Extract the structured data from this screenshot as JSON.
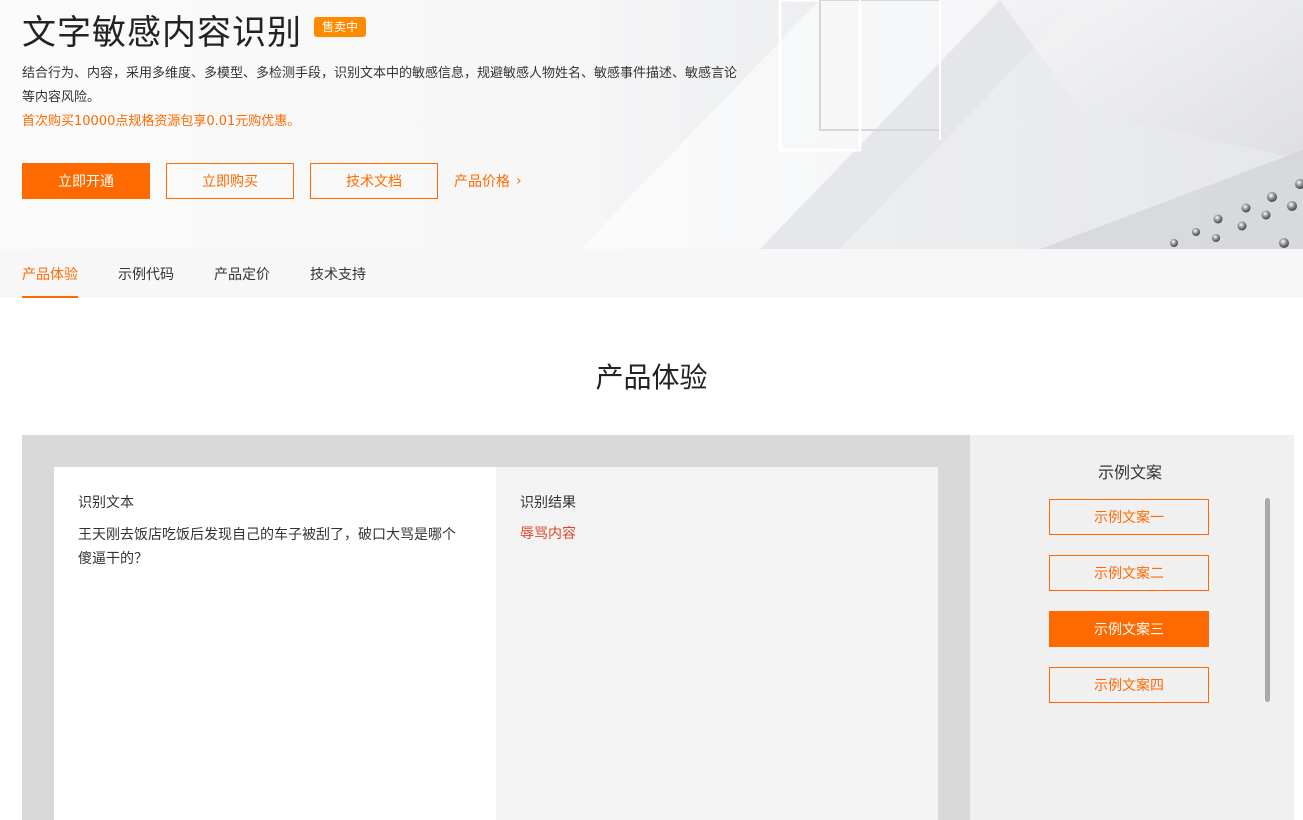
{
  "hero": {
    "title": "文字敏感内容识别",
    "badge": "售卖中",
    "description": "结合行为、内容，采用多维度、多模型、多检测手段，识别文本中的敏感信息，规避敏感人物姓名、敏感事件描述、敏感言论等内容风险。",
    "promo": "首次购买10000点规格资源包享0.01元购优惠。",
    "buttons": {
      "activate": "立即开通",
      "buy": "立即购买",
      "docs": "技术文档",
      "pricing": "产品价格"
    },
    "pricing_icon": "chevron-right-icon"
  },
  "tabs": [
    {
      "label": "产品体验",
      "active": true
    },
    {
      "label": "示例代码",
      "active": false
    },
    {
      "label": "产品定价",
      "active": false
    },
    {
      "label": "技术支持",
      "active": false
    }
  ],
  "section": {
    "title": "产品体验"
  },
  "demo": {
    "input_label": "识别文本",
    "input_text": "王天刚去饭店吃饭后发现自己的车子被刮了，破口大骂是哪个傻逼干的？",
    "result_label": "识别结果",
    "result_text": "辱骂内容"
  },
  "samples": {
    "title": "示例文案",
    "items": [
      {
        "label": "示例文案一",
        "active": false
      },
      {
        "label": "示例文案二",
        "active": false
      },
      {
        "label": "示例文案三",
        "active": true
      },
      {
        "label": "示例文案四",
        "active": false
      }
    ]
  },
  "colors": {
    "accent": "#ff6a00",
    "badge": "#ff8a00",
    "result": "#e0452b"
  }
}
